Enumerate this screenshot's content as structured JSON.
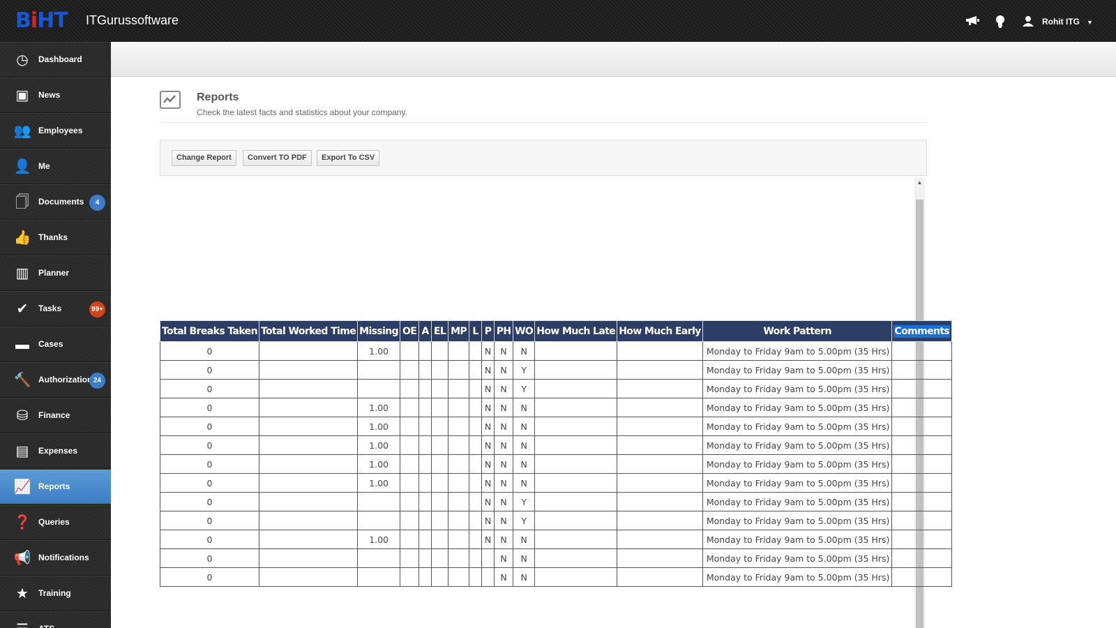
{
  "app": {
    "brand_name": "ITGurussoftware",
    "logo_letters": [
      "B",
      "i",
      "H",
      "T"
    ]
  },
  "topbar": {
    "icons": [
      "megaphone-icon",
      "lightbulb-icon",
      "user-icon"
    ],
    "user_name": "Rohit ITG"
  },
  "sidebar": {
    "items": [
      {
        "label": "Dashboard",
        "icon": "dashboard-icon",
        "glyph": "◷"
      },
      {
        "label": "News",
        "icon": "tv-icon",
        "glyph": "▣"
      },
      {
        "label": "Employees",
        "icon": "group-icon",
        "glyph": "👥"
      },
      {
        "label": "Me",
        "icon": "user-star-icon",
        "glyph": "👤"
      },
      {
        "label": "Documents",
        "icon": "documents-icon",
        "glyph": "🗍",
        "badge": "4",
        "badge_color": "#3d7cc9"
      },
      {
        "label": "Thanks",
        "icon": "thumbs-up-icon",
        "glyph": "👍"
      },
      {
        "label": "Planner",
        "icon": "planner-icon",
        "glyph": "▥"
      },
      {
        "label": "Tasks",
        "icon": "check-icon",
        "glyph": "✔",
        "badge": "99+",
        "badge_color": "#d2441c"
      },
      {
        "label": "Cases",
        "icon": "folder-icon",
        "glyph": "▬"
      },
      {
        "label": "Authorizations",
        "icon": "gavel-icon",
        "glyph": "🔨",
        "badge": "24",
        "badge_color": "#3d7cc9"
      },
      {
        "label": "Finance",
        "icon": "finance-icon",
        "glyph": "⛁"
      },
      {
        "label": "Expenses",
        "icon": "wallet-icon",
        "glyph": "▤"
      },
      {
        "label": "Reports",
        "icon": "chart-icon",
        "glyph": "📈",
        "active": true
      },
      {
        "label": "Queries",
        "icon": "question-icon",
        "glyph": "❓"
      },
      {
        "label": "Notifications",
        "icon": "megaphone-icon",
        "glyph": "📢"
      },
      {
        "label": "Training",
        "icon": "star-icon",
        "glyph": "★"
      },
      {
        "label": "ATS",
        "icon": "list-icon",
        "glyph": "☰"
      }
    ]
  },
  "page": {
    "title": "Reports",
    "subtitle": "Check the latest facts and statistics about your company."
  },
  "toolbar": {
    "change_report": "Change Report",
    "convert_pdf": "Convert TO PDF",
    "export_csv": "Export To CSV"
  },
  "table": {
    "headers": [
      "Total Breaks Taken",
      "Total Worked Time",
      "Missing",
      "OE",
      "A",
      "EL",
      "MP",
      "L",
      "P",
      "PH",
      "WO",
      "How Much Late",
      "How Much Early",
      "Work Pattern",
      "Comments"
    ],
    "rows": [
      [
        "0",
        "",
        "1.00",
        "",
        "",
        "",
        "",
        "",
        "N",
        "N",
        "N",
        "",
        "",
        "Monday to Friday 9am to 5.00pm (35 Hrs)",
        ""
      ],
      [
        "0",
        "",
        "",
        "",
        "",
        "",
        "",
        "",
        "N",
        "N",
        "Y",
        "",
        "",
        "Monday to Friday 9am to 5.00pm (35 Hrs)",
        ""
      ],
      [
        "0",
        "",
        "",
        "",
        "",
        "",
        "",
        "",
        "N",
        "N",
        "Y",
        "",
        "",
        "Monday to Friday 9am to 5.00pm (35 Hrs)",
        ""
      ],
      [
        "0",
        "",
        "1.00",
        "",
        "",
        "",
        "",
        "",
        "N",
        "N",
        "N",
        "",
        "",
        "Monday to Friday 9am to 5.00pm (35 Hrs)",
        ""
      ],
      [
        "0",
        "",
        "1.00",
        "",
        "",
        "",
        "",
        "",
        "N",
        "N",
        "N",
        "",
        "",
        "Monday to Friday 9am to 5.00pm (35 Hrs)",
        ""
      ],
      [
        "0",
        "",
        "1.00",
        "",
        "",
        "",
        "",
        "",
        "N",
        "N",
        "N",
        "",
        "",
        "Monday to Friday 9am to 5.00pm (35 Hrs)",
        ""
      ],
      [
        "0",
        "",
        "1.00",
        "",
        "",
        "",
        "",
        "",
        "N",
        "N",
        "N",
        "",
        "",
        "Monday to Friday 9am to 5.00pm (35 Hrs)",
        ""
      ],
      [
        "0",
        "",
        "1.00",
        "",
        "",
        "",
        "",
        "",
        "N",
        "N",
        "N",
        "",
        "",
        "Monday to Friday 9am to 5.00pm (35 Hrs)",
        ""
      ],
      [
        "0",
        "",
        "",
        "",
        "",
        "",
        "",
        "",
        "N",
        "N",
        "Y",
        "",
        "",
        "Monday to Friday 9am to 5.00pm (35 Hrs)",
        ""
      ],
      [
        "0",
        "",
        "",
        "",
        "",
        "",
        "",
        "",
        "N",
        "N",
        "Y",
        "",
        "",
        "Monday to Friday 9am to 5.00pm (35 Hrs)",
        ""
      ],
      [
        "0",
        "",
        "1.00",
        "",
        "",
        "",
        "",
        "",
        "N",
        "N",
        "N",
        "",
        "",
        "Monday to Friday 9am to 5.00pm (35 Hrs)",
        ""
      ],
      [
        "0",
        "",
        "",
        "",
        "",
        "",
        "",
        "",
        "",
        "N",
        "N",
        "",
        "",
        "Monday to Friday 9am to 5.00pm (35 Hrs)",
        ""
      ],
      [
        "0",
        "",
        "",
        "",
        "",
        "",
        "",
        "",
        "",
        "N",
        "N",
        "",
        "",
        "Monday to Friday 9am to 5.00pm (35 Hrs)",
        ""
      ]
    ]
  }
}
